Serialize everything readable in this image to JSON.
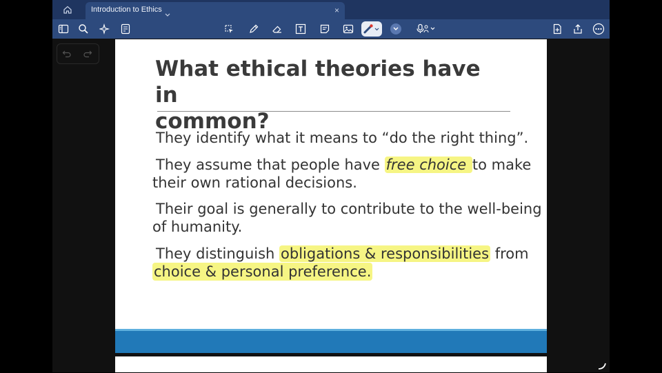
{
  "tab": {
    "title": "Introduction to Ethics",
    "close": "×"
  },
  "toolbar": {
    "left_icons": [
      "sidebar-icon",
      "search-icon",
      "sparkle-icon",
      "notes-icon"
    ],
    "center_icons": [
      "lasso-icon",
      "pen-icon",
      "eraser-icon",
      "textbox-icon",
      "sticky-note-icon",
      "image-icon",
      "laser-pointer-icon",
      "chevron-down-icon",
      "microphone-icon"
    ],
    "right_icons": [
      "add-page-icon",
      "share-icon",
      "more-icon"
    ]
  },
  "slide": {
    "title_line1": "What ethical theories have in",
    "title_line2": "common?",
    "bullets": [
      {
        "l1": "They identify what it means to “do the right thing”."
      },
      {
        "l1_a": "They assume that people have ",
        "l1_hl": "free choice ",
        "l1_b": "to make",
        "l2": "their own rational decisions."
      },
      {
        "l1": "Their goal is generally to contribute to the well-being",
        "l2": "of humanity."
      },
      {
        "l1_a": "They distinguish ",
        "l1_hl": "obligations & responsibilities",
        "l1_b": " from",
        "l2_hl": "choice & personal preference."
      }
    ]
  },
  "colors": {
    "tab_bar": "#1f3560",
    "toolbar": "#2d4a7d",
    "highlight": "#f6f584",
    "slide_footer": "#2179b8",
    "title_text": "#3a3a3a"
  }
}
